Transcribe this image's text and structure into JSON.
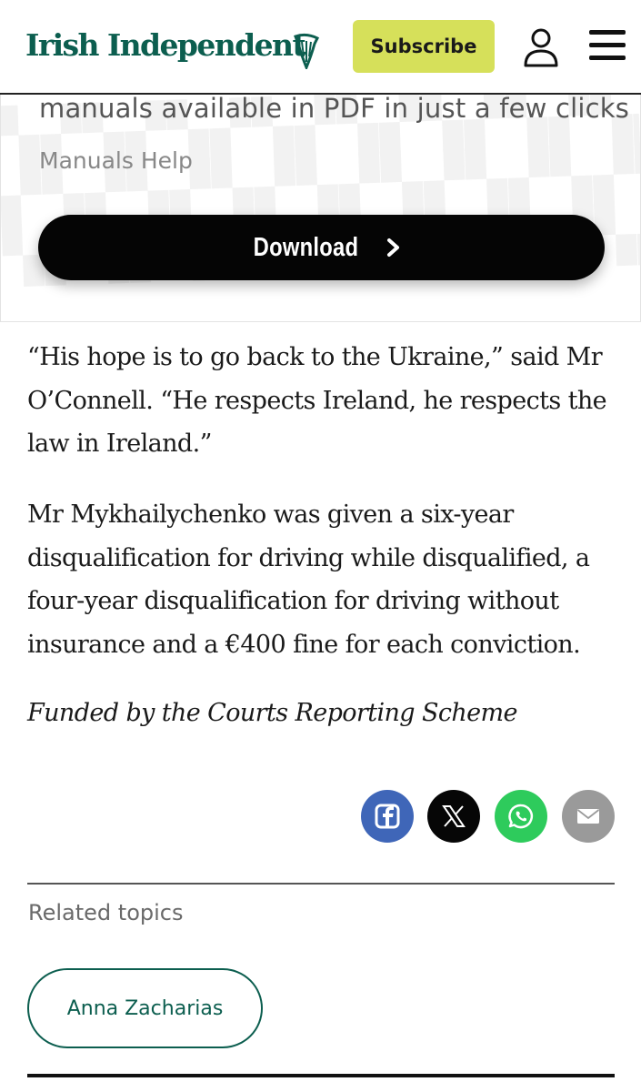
{
  "header": {
    "logo_text": "Irish Independent",
    "subscribe_label": "Subscribe",
    "brand_color": "#0c5e4f",
    "subscribe_color": "#d6e05a"
  },
  "ad": {
    "headline": "manuals available in PDF in just a few clicks",
    "source": "Manuals Help",
    "download_label": "Download"
  },
  "article": {
    "paragraphs": [
      "“His hope is to go back to the Ukraine,” said Mr O’Connell. “He respects Ireland, he respects the law in Ireland.”",
      "Mr Mykhailychenko was given a six-year disqualification for driving while disqualified, a four-year disqualification for driving without insurance and a €400 fine for each conviction."
    ],
    "credit": "Funded by the Courts Reporting Scheme"
  },
  "share": {
    "icons": [
      "facebook-icon",
      "x-icon",
      "whatsapp-icon",
      "email-icon"
    ]
  },
  "related": {
    "label": "Related topics",
    "topics": [
      "Anna Zacharias"
    ]
  }
}
